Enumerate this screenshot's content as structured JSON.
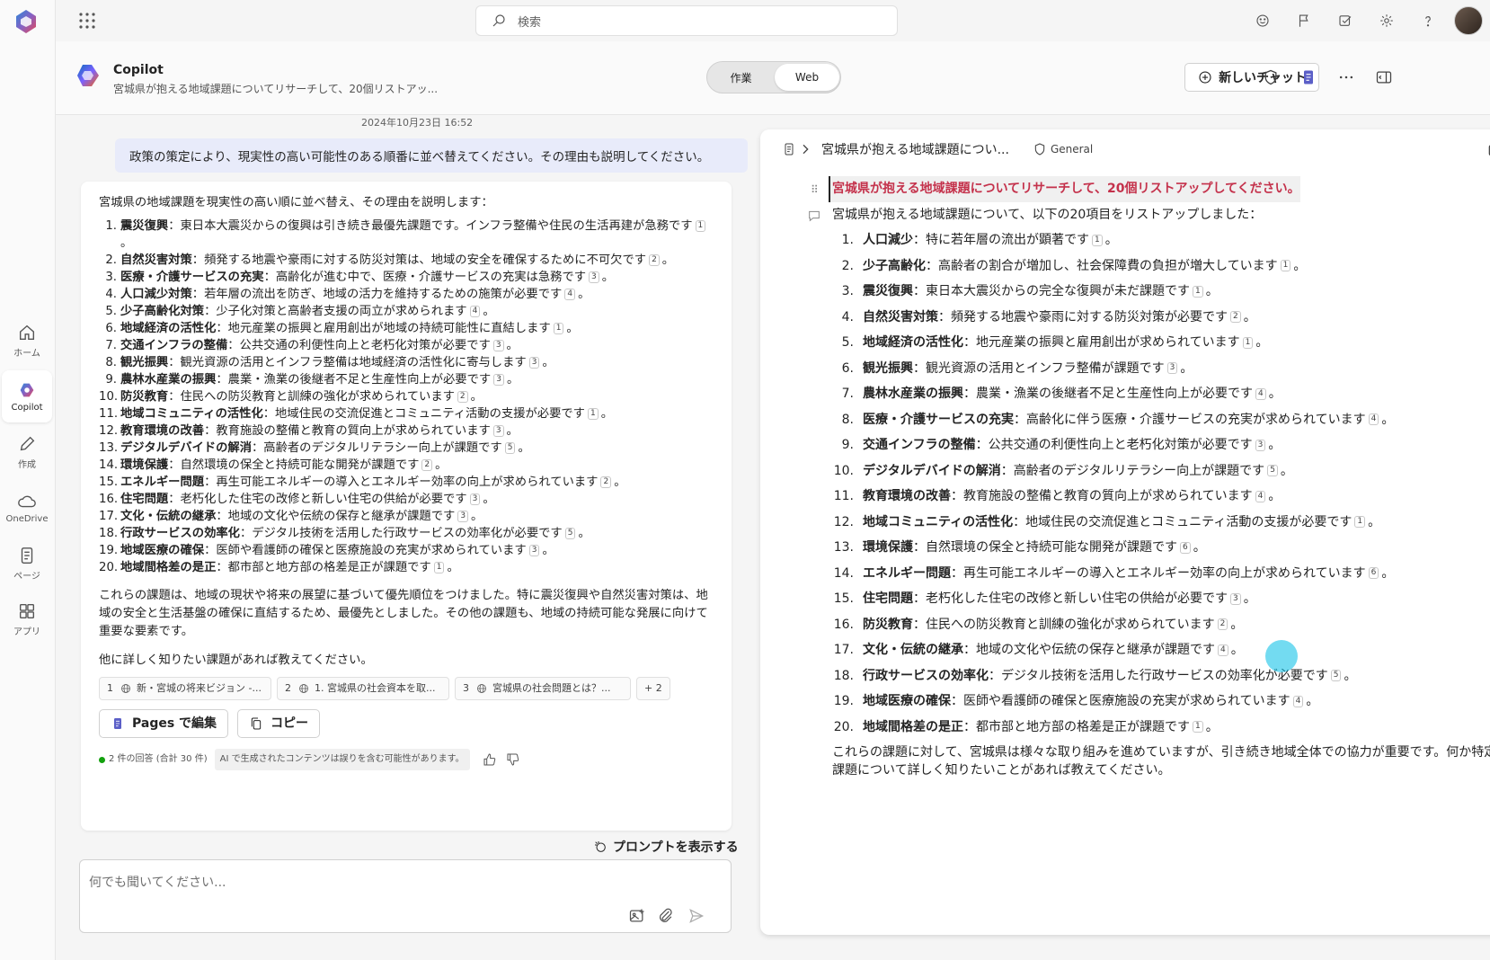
{
  "app": {
    "title": "Copilot"
  },
  "search": {
    "placeholder": "検索"
  },
  "rail": {
    "items": [
      {
        "label": "ホーム"
      },
      {
        "label": "Copilot"
      },
      {
        "label": "作成"
      },
      {
        "label": "OneDrive"
      },
      {
        "label": "ページ"
      },
      {
        "label": "アプリ"
      }
    ]
  },
  "header": {
    "title": "Copilot",
    "subtitle": "宮城県が抱える地域課題についてリサーチして、20個リストアッ...",
    "toggle": {
      "work": "作業",
      "web": "Web"
    },
    "new_chat": "新しいチャット"
  },
  "chat": {
    "timestamp": "2024年10月23日 16:52",
    "user_message": "政策の策定により、現実性の高い可能性のある順番に並べ替えてください。その理由も説明してください。",
    "intro": "宮城県の地域課題を現実性の高い順に並べ替え、その理由を説明します：",
    "items": [
      {
        "n": "1.",
        "title": "震災復興",
        "text": "：東日本大震災からの復興は引き続き最優先課題です。インフラ整備や住民の生活再建が急務です",
        "cite": "1"
      },
      {
        "n": "2.",
        "title": "自然災害対策",
        "text": "：頻発する地震や豪雨に対する防災対策は、地域の安全を確保するために不可欠です",
        "cite": "2"
      },
      {
        "n": "3.",
        "title": "医療・介護サービスの充実",
        "text": "：高齢化が進む中で、医療・介護サービスの充実は急務です",
        "cite": "3"
      },
      {
        "n": "4.",
        "title": "人口減少対策",
        "text": "：若年層の流出を防ぎ、地域の活力を維持するための施策が必要です",
        "cite": "4"
      },
      {
        "n": "5.",
        "title": "少子高齢化対策",
        "text": "：少子化対策と高齢者支援の両立が求められます",
        "cite": "4"
      },
      {
        "n": "6.",
        "title": "地域経済の活性化",
        "text": "：地元産業の振興と雇用創出が地域の持続可能性に直結します",
        "cite": "1"
      },
      {
        "n": "7.",
        "title": "交通インフラの整備",
        "text": "：公共交通の利便性向上と老朽化対策が必要です",
        "cite": "3"
      },
      {
        "n": "8.",
        "title": "観光振興",
        "text": "：観光資源の活用とインフラ整備は地域経済の活性化に寄与します",
        "cite": "3"
      },
      {
        "n": "9.",
        "title": "農林水産業の振興",
        "text": "：農業・漁業の後継者不足と生産性向上が必要です",
        "cite": "3"
      },
      {
        "n": "10.",
        "title": "防災教育",
        "text": "：住民への防災教育と訓練の強化が求められています",
        "cite": "2"
      },
      {
        "n": "11.",
        "title": "地域コミュニティの活性化",
        "text": "：地域住民の交流促進とコミュニティ活動の支援が必要です",
        "cite": "1"
      },
      {
        "n": "12.",
        "title": "教育環境の改善",
        "text": "：教育施設の整備と教育の質向上が求められています",
        "cite": "3"
      },
      {
        "n": "13.",
        "title": "デジタルデバイドの解消",
        "text": "：高齢者のデジタルリテラシー向上が課題です",
        "cite": "5"
      },
      {
        "n": "14.",
        "title": "環境保護",
        "text": "：自然環境の保全と持続可能な開発が課題です",
        "cite": "2"
      },
      {
        "n": "15.",
        "title": "エネルギー問題",
        "text": "：再生可能エネルギーの導入とエネルギー効率の向上が求められています",
        "cite": "2"
      },
      {
        "n": "16.",
        "title": "住宅問題",
        "text": "：老朽化した住宅の改修と新しい住宅の供給が必要です",
        "cite": "3"
      },
      {
        "n": "17.",
        "title": "文化・伝統の継承",
        "text": "：地域の文化や伝統の保存と継承が課題です",
        "cite": "3"
      },
      {
        "n": "18.",
        "title": "行政サービスの効率化",
        "text": "：デジタル技術を活用した行政サービスの効率化が必要です",
        "cite": "5"
      },
      {
        "n": "19.",
        "title": "地域医療の確保",
        "text": "：医師や看護師の確保と医療施設の充実が求められています",
        "cite": "3"
      },
      {
        "n": "20.",
        "title": "地域間格差の是正",
        "text": "：都市部と地方部の格差是正が課題です",
        "cite": "1"
      }
    ],
    "conclusion": "これらの課題は、地域の現状や将来の展望に基づいて優先順位をつけました。特に震災復興や自然災害対策は、地域の安全と生活基盤の確保に直結するため、最優先としました。その他の課題も、地域の持続可能な発展に向けて重要な要素です。",
    "followup": "他に詳しく知りたい課題があれば教えてください。",
    "refs": [
      {
        "num": "1",
        "label": "新・宮城の将来ビジョン -..."
      },
      {
        "num": "2",
        "label": "1. 宮城県の社会資本を取..."
      },
      {
        "num": "3",
        "label": "宮城県の社会問題とは？..."
      }
    ],
    "refs_more": "+ 2",
    "edit_pages": "Pages で編集",
    "copy": "コピー",
    "responses": "2 件の回答 (合計 30 件)",
    "ai_notice": "AI で生成されたコンテンツは誤りを含む可能性があります。",
    "show_prompt": "プロンプトを表示する",
    "composer_placeholder": "何でも聞いてください..."
  },
  "page": {
    "breadcrumb": "宮城県が抱える地域課題につい...",
    "tag": "General",
    "title": "宮城県が抱える地域課題についてリサーチして、20個リストアップしてください。",
    "intro": "宮城県が抱える地域課題について、以下の20項目をリストアップしました：",
    "items": [
      {
        "n": "1.",
        "title": "人口減少",
        "text": "：特に若年層の流出が顕著です",
        "cite": "1"
      },
      {
        "n": "2.",
        "title": "少子高齢化",
        "text": "：高齢者の割合が増加し、社会保障費の負担が増大しています",
        "cite": "1"
      },
      {
        "n": "3.",
        "title": "震災復興",
        "text": "：東日本大震災からの完全な復興が未だ課題です",
        "cite": "1"
      },
      {
        "n": "4.",
        "title": "自然災害対策",
        "text": "：頻発する地震や豪雨に対する防災対策が必要です",
        "cite": "2"
      },
      {
        "n": "5.",
        "title": "地域経済の活性化",
        "text": "：地元産業の振興と雇用創出が求められています",
        "cite": "1"
      },
      {
        "n": "6.",
        "title": "観光振興",
        "text": "：観光資源の活用とインフラ整備が課題です",
        "cite": "3"
      },
      {
        "n": "7.",
        "title": "農林水産業の振興",
        "text": "：農業・漁業の後継者不足と生産性向上が必要です",
        "cite": "4"
      },
      {
        "n": "8.",
        "title": "医療・介護サービスの充実",
        "text": "：高齢化に伴う医療・介護サービスの充実が求められています",
        "cite": "4"
      },
      {
        "n": "9.",
        "title": "交通インフラの整備",
        "text": "：公共交通の利便性向上と老朽化対策が必要です",
        "cite": "3"
      },
      {
        "n": "10.",
        "title": "デジタルデバイドの解消",
        "text": "：高齢者のデジタルリテラシー向上が課題です",
        "cite": "5"
      },
      {
        "n": "11.",
        "title": "教育環境の改善",
        "text": "：教育施設の整備と教育の質向上が求められています",
        "cite": "4"
      },
      {
        "n": "12.",
        "title": "地域コミュニティの活性化",
        "text": "：地域住民の交流促進とコミュニティ活動の支援が必要です",
        "cite": "1"
      },
      {
        "n": "13.",
        "title": "環境保護",
        "text": "：自然環境の保全と持続可能な開発が課題です",
        "cite": "6"
      },
      {
        "n": "14.",
        "title": "エネルギー問題",
        "text": "：再生可能エネルギーの導入とエネルギー効率の向上が求められています",
        "cite": "6"
      },
      {
        "n": "15.",
        "title": "住宅問題",
        "text": "：老朽化した住宅の改修と新しい住宅の供給が必要です",
        "cite": "3"
      },
      {
        "n": "16.",
        "title": "防災教育",
        "text": "：住民への防災教育と訓練の強化が求められています",
        "cite": "2"
      },
      {
        "n": "17.",
        "title": "文化・伝統の継承",
        "text": "：地域の文化や伝統の保存と継承が課題です",
        "cite": "4"
      },
      {
        "n": "18.",
        "title": "行政サービスの効率化",
        "text": "：デジタル技術を活用した行政サービスの効率化が必要です",
        "cite": "5"
      },
      {
        "n": "19.",
        "title": "地域医療の確保",
        "text": "：医師や看護師の確保と医療施設の充実が求められています",
        "cite": "4"
      },
      {
        "n": "20.",
        "title": "地域間格差の是正",
        "text": "：都市部と地方部の格差是正が課題です",
        "cite": "1"
      }
    ],
    "conclusion": "これらの課題に対して、宮城県は様々な取り組みを進めていますが、引き続き地域全体での協力が重要です。何か特定の課題について詳しく知りたいことがあれば教えてください。"
  },
  "colors": {
    "accent": "#5b5fc7",
    "page_title": "#c4314b",
    "bubble": "#e8ebfa"
  }
}
